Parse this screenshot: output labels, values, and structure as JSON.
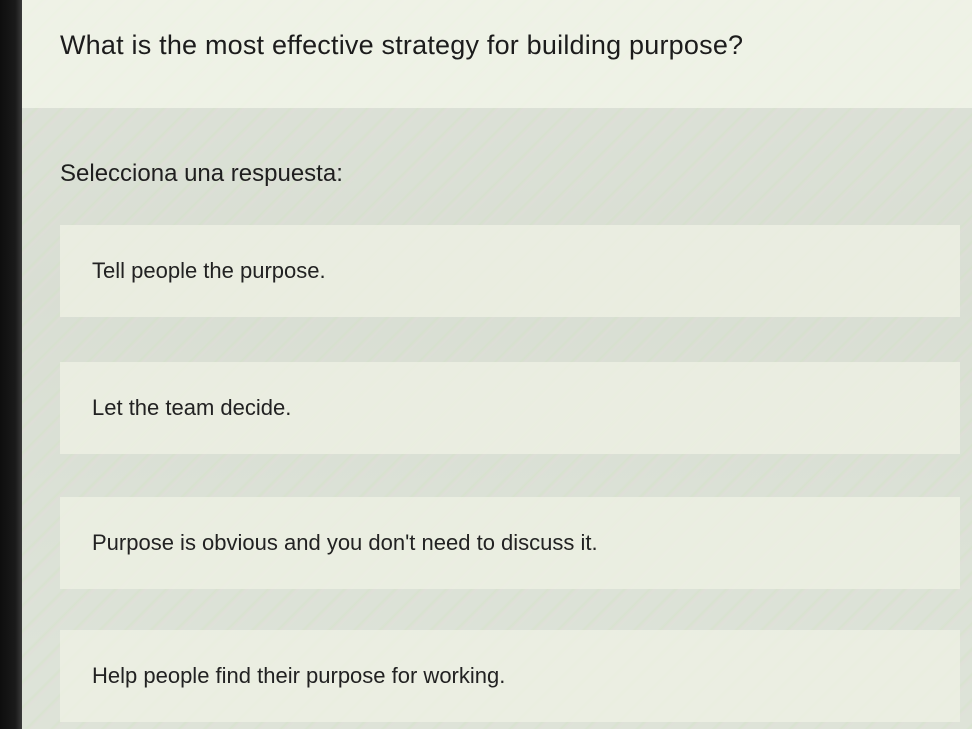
{
  "quiz": {
    "question": "What is the most effective strategy for building purpose?",
    "prompt": "Selecciona una respuesta:",
    "options": [
      {
        "label": "Tell people the purpose."
      },
      {
        "label": "Let the team decide."
      },
      {
        "label": "Purpose is obvious and you don't need to discuss it."
      },
      {
        "label": "Help people find their purpose for working."
      }
    ]
  }
}
